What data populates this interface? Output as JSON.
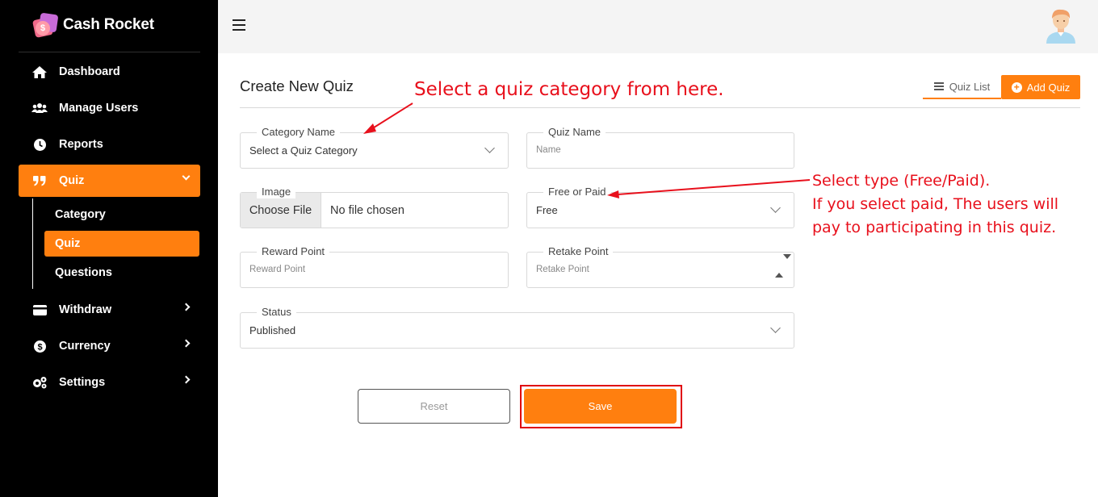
{
  "brand": {
    "name": "Cash Rocket"
  },
  "sidebar": {
    "items": [
      {
        "label": "Dashboard",
        "icon": "home-icon"
      },
      {
        "label": "Manage Users",
        "icon": "users-icon"
      },
      {
        "label": "Reports",
        "icon": "clock-icon"
      },
      {
        "label": "Quiz",
        "icon": "quote-icon",
        "expanded": true
      },
      {
        "label": "Withdraw",
        "icon": "card-icon"
      },
      {
        "label": "Currency",
        "icon": "dollar-icon"
      },
      {
        "label": "Settings",
        "icon": "gears-icon"
      }
    ],
    "quiz_sub": [
      {
        "label": "Category"
      },
      {
        "label": "Quiz",
        "active": true
      },
      {
        "label": "Questions"
      }
    ]
  },
  "header": {
    "page_title": "Create New Quiz",
    "quiz_list_label": "Quiz List",
    "add_quiz_label": "Add Quiz"
  },
  "form": {
    "category": {
      "legend": "Category Name",
      "value": "Select a Quiz Category"
    },
    "quiz_name": {
      "legend": "Quiz Name",
      "placeholder": "Name"
    },
    "image": {
      "legend": "Image",
      "button": "Choose File",
      "file": "No file chosen"
    },
    "free_paid": {
      "legend": "Free or Paid",
      "value": "Free"
    },
    "reward": {
      "legend": "Reward Point",
      "placeholder": "Reward Point"
    },
    "retake": {
      "legend": "Retake Point",
      "placeholder": "Retake Point"
    },
    "status": {
      "legend": "Status",
      "value": "Published"
    },
    "reset_label": "Reset",
    "save_label": "Save"
  },
  "annotations": {
    "category_hint": "Select a quiz category from here.",
    "type_line1": "Select type (Free/Paid).",
    "type_line2": "If you select paid, The users will",
    "type_line3": "pay to participating in this quiz."
  },
  "colors": {
    "accent": "#ff7f0f",
    "sidebar_bg": "#000000",
    "annotation": "#e8101c"
  }
}
